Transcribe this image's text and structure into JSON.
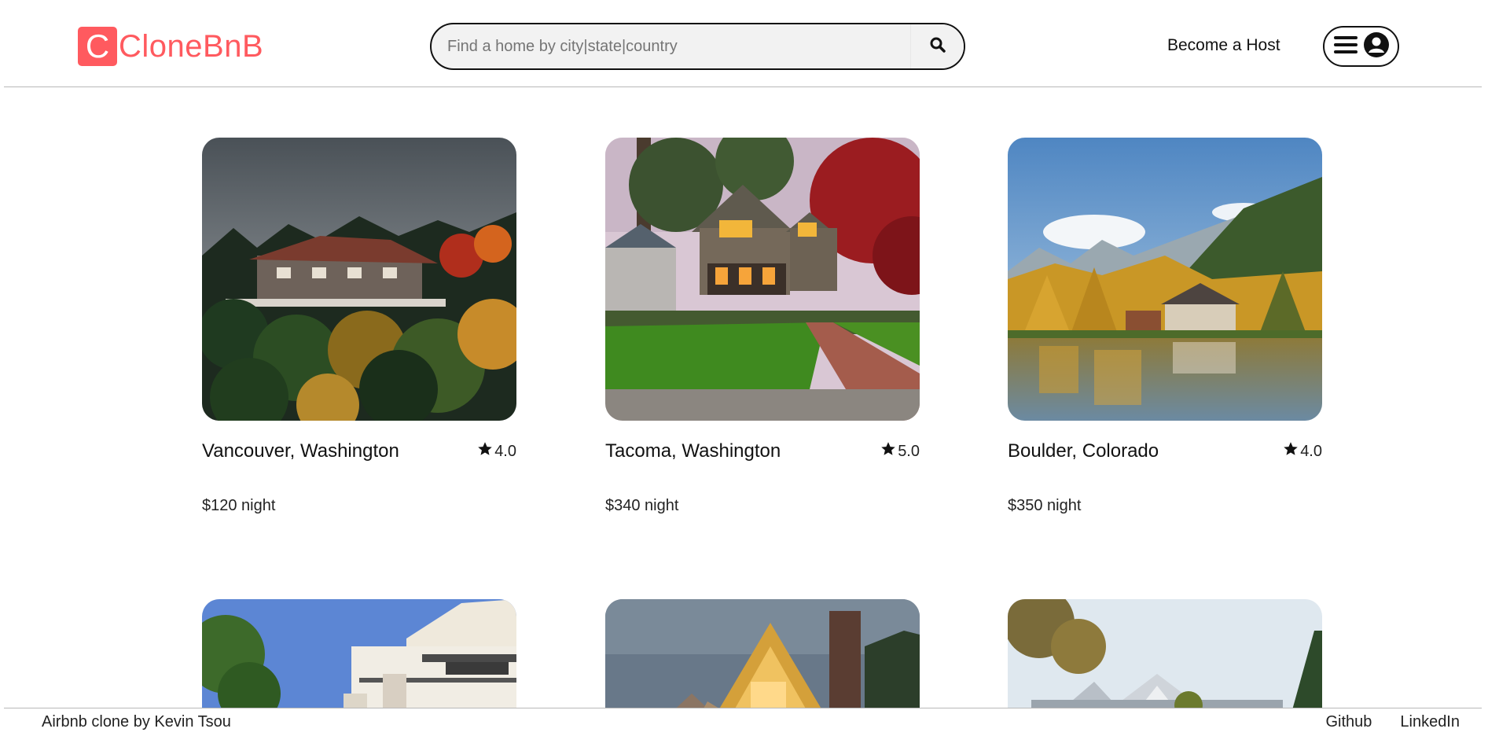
{
  "header": {
    "logo_letter": "C",
    "logo_text": "CloneBnB",
    "search_placeholder": "Find a home by city|state|country",
    "host_link": "Become a Host",
    "menu_icon": "hamburger-icon",
    "profile_icon": "user-circle-icon"
  },
  "listings": [
    {
      "city": "Vancouver, Washington",
      "rating": "4.0",
      "price": "$120 night"
    },
    {
      "city": "Tacoma, Washington",
      "rating": "5.0",
      "price": "$340 night"
    },
    {
      "city": "Boulder, Colorado",
      "rating": "4.0",
      "price": "$350 night"
    }
  ],
  "footer": {
    "credit": "Airbnb clone by Kevin Tsou",
    "links": [
      "Github",
      "LinkedIn"
    ]
  },
  "colors": {
    "brand": "#ff5a5f",
    "text": "#222222"
  }
}
